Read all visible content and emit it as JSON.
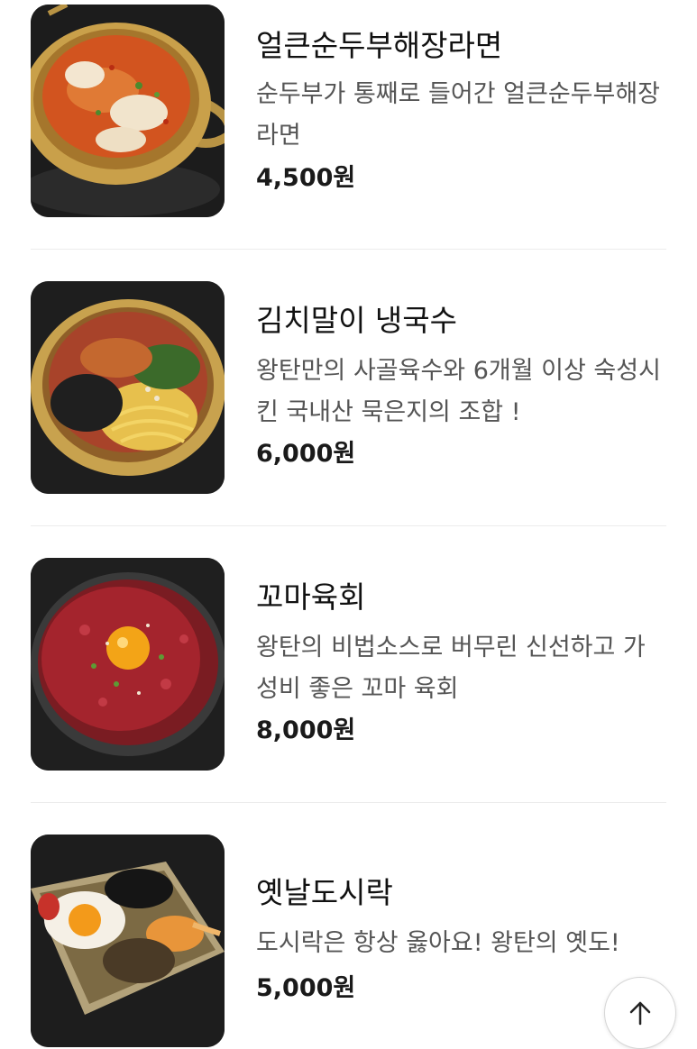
{
  "menu": {
    "items": [
      {
        "name": "얼큰순두부해장라면",
        "description": "순두부가 통째로 들어간 얼큰순두부해장라면",
        "price": "4,500원",
        "image": "ramen-pot-photo"
      },
      {
        "name": "김치말이 냉국수",
        "description": "왕탄만의 사골육수와 6개월 이상 숙성시킨 국내산 묵은지의 조합 !",
        "price": "6,000원",
        "image": "cold-noodle-pot-photo"
      },
      {
        "name": "꼬마육회",
        "description": "왕탄의 비법소스로 버무린 신선하고 가성비 좋은 꼬마 육회",
        "price": "8,000원",
        "image": "beef-tartare-photo"
      },
      {
        "name": "옛날도시락",
        "description": "도시락은 항상 옳아요! 왕탄의 옛도!",
        "price": "5,000원",
        "image": "lunchbox-photo"
      }
    ]
  },
  "scroll_top": {
    "icon": "arrow-up-icon"
  },
  "colors": {
    "price_text": "#1a1a1a",
    "description_text": "#555555",
    "divider": "#ececec"
  }
}
